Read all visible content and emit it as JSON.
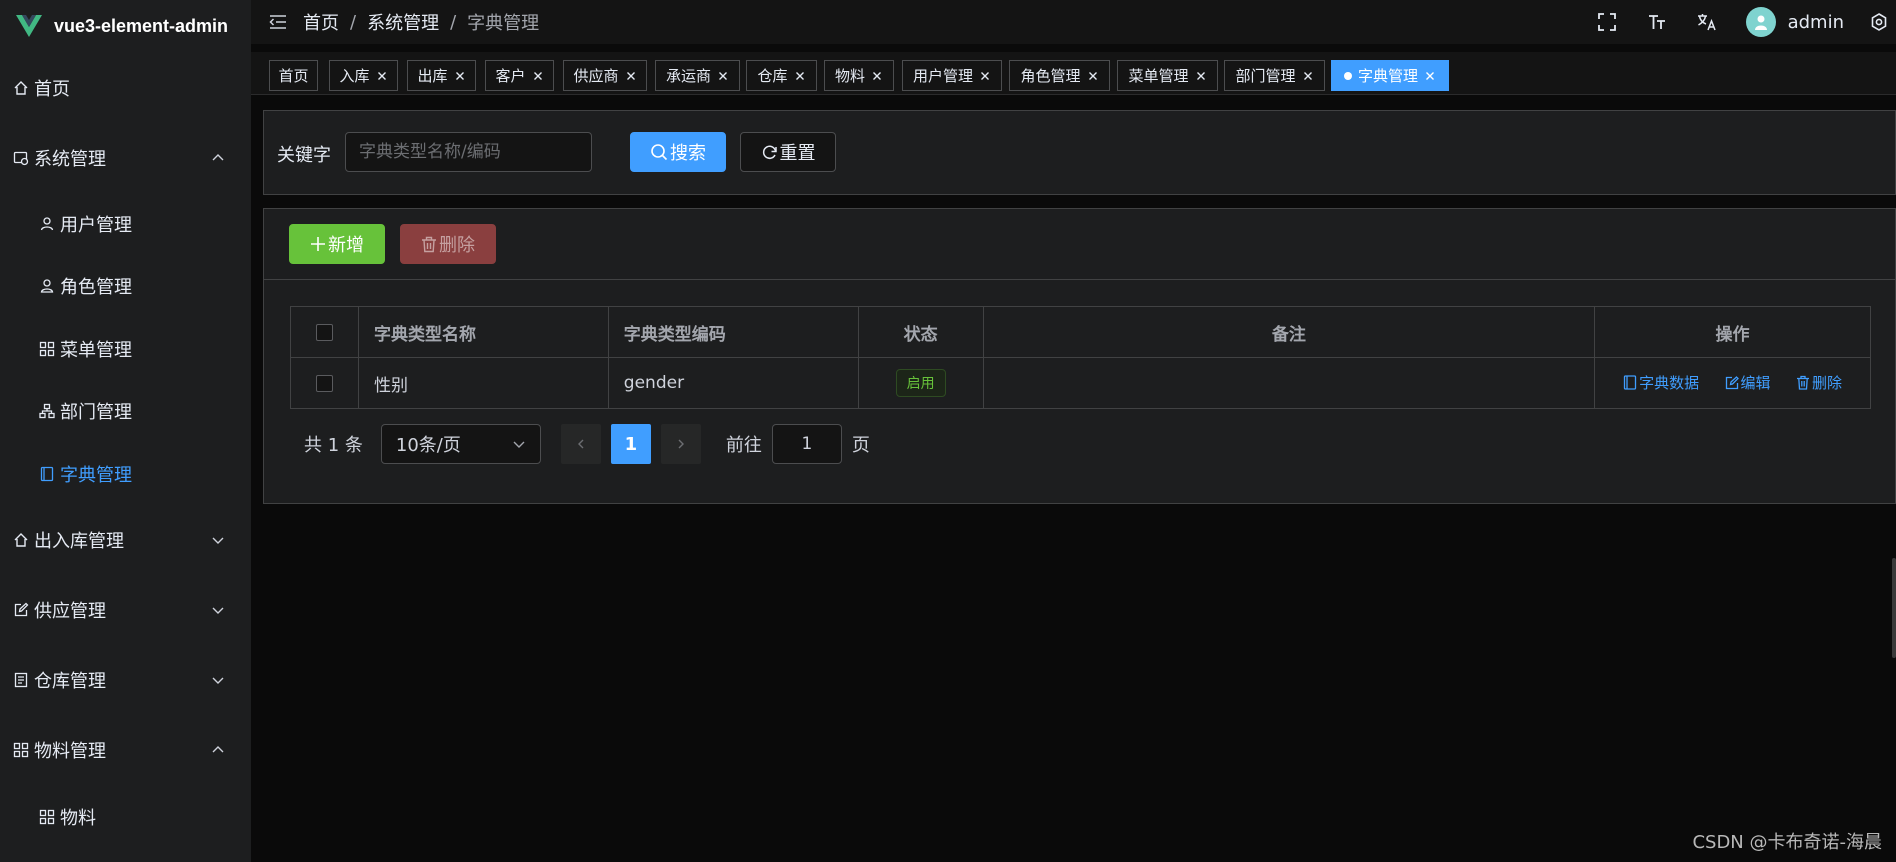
{
  "app": {
    "title": "vue3-element-admin"
  },
  "header": {
    "breadcrumb": [
      "首页",
      "系统管理",
      "字典管理"
    ],
    "separator": "/",
    "username": "admin"
  },
  "sidebar": {
    "items": [
      {
        "label": "首页",
        "icon": "home-icon"
      },
      {
        "label": "系统管理",
        "icon": "system-icon",
        "expanded": true
      },
      {
        "label": "用户管理",
        "icon": "user-icon"
      },
      {
        "label": "角色管理",
        "icon": "role-icon"
      },
      {
        "label": "菜单管理",
        "icon": "menu-icon"
      },
      {
        "label": "部门管理",
        "icon": "tree-icon"
      },
      {
        "label": "字典管理",
        "icon": "dict-icon",
        "active": true
      },
      {
        "label": "出入库管理",
        "icon": "home-icon",
        "expanded": false
      },
      {
        "label": "供应管理",
        "icon": "edit-icon",
        "expanded": false
      },
      {
        "label": "仓库管理",
        "icon": "document-icon",
        "expanded": false
      },
      {
        "label": "物料管理",
        "icon": "grid-icon",
        "expanded": true
      },
      {
        "label": "物料",
        "icon": "grid-icon"
      }
    ]
  },
  "tags": [
    {
      "label": "首页",
      "closable": false
    },
    {
      "label": "入库",
      "closable": true
    },
    {
      "label": "出库",
      "closable": true
    },
    {
      "label": "客户",
      "closable": true
    },
    {
      "label": "供应商",
      "closable": true
    },
    {
      "label": "承运商",
      "closable": true
    },
    {
      "label": "仓库",
      "closable": true
    },
    {
      "label": "物料",
      "closable": true
    },
    {
      "label": "用户管理",
      "closable": true
    },
    {
      "label": "角色管理",
      "closable": true
    },
    {
      "label": "菜单管理",
      "closable": true
    },
    {
      "label": "部门管理",
      "closable": true
    },
    {
      "label": "字典管理",
      "closable": true,
      "active": true
    }
  ],
  "search": {
    "label": "关键字",
    "placeholder": "字典类型名称/编码",
    "value": "",
    "search_label": "搜索",
    "reset_label": "重置"
  },
  "toolbar": {
    "add_label": "新增",
    "delete_label": "删除"
  },
  "table": {
    "columns": [
      "字典类型名称",
      "字典类型编码",
      "状态",
      "备注",
      "操作"
    ],
    "rows": [
      {
        "name": "性别",
        "code": "gender",
        "status": "启用",
        "remark": ""
      }
    ],
    "actions": [
      "字典数据",
      "编辑",
      "删除"
    ]
  },
  "pagination": {
    "total_text": "共 1 条",
    "page_size": "10条/页",
    "current_page": "1",
    "goto_prefix": "前往",
    "goto_value": "1",
    "goto_suffix": "页"
  },
  "watermark": "CSDN @卡布奇诺-海晨",
  "colors": {
    "primary": "#409eff",
    "success": "#67c23a",
    "danger_disabled": "#8a3f3f",
    "sidebar_bg": "#1d1e1f",
    "page_bg": "#0a0a0a"
  }
}
